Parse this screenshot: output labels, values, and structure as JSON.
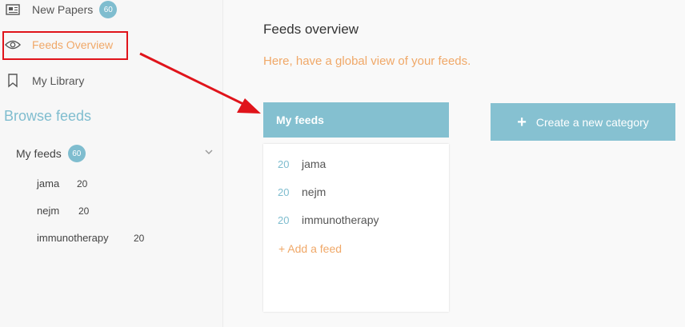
{
  "sidebar": {
    "items": [
      {
        "label": "New Papers",
        "badge": "60",
        "icon": "newspaper-icon"
      },
      {
        "label": "Feeds Overview",
        "icon": "eye-icon",
        "active": true
      },
      {
        "label": "My Library",
        "icon": "bookmark-icon"
      }
    ],
    "browse_title": "Browse feeds",
    "my_feeds": {
      "label": "My feeds",
      "badge": "60"
    },
    "feeds": [
      {
        "name": "jama",
        "count": "20"
      },
      {
        "name": "nejm",
        "count": "20"
      },
      {
        "name": "immunotherapy",
        "count": "20"
      }
    ]
  },
  "main": {
    "title": "Feeds overview",
    "subtitle": "Here, have a global view of your feeds.",
    "card": {
      "header": "My feeds",
      "rows": [
        {
          "count": "20",
          "name": "jama"
        },
        {
          "count": "20",
          "name": "nejm"
        },
        {
          "count": "20",
          "name": "immunotherapy"
        }
      ],
      "add_feed": "+ Add a feed"
    },
    "create_button": {
      "plus": "+",
      "label": "Create a new category"
    }
  },
  "colors": {
    "accent": "#7fbdcf",
    "orange": "#f0a868",
    "annotation_red": "#e0141b"
  }
}
